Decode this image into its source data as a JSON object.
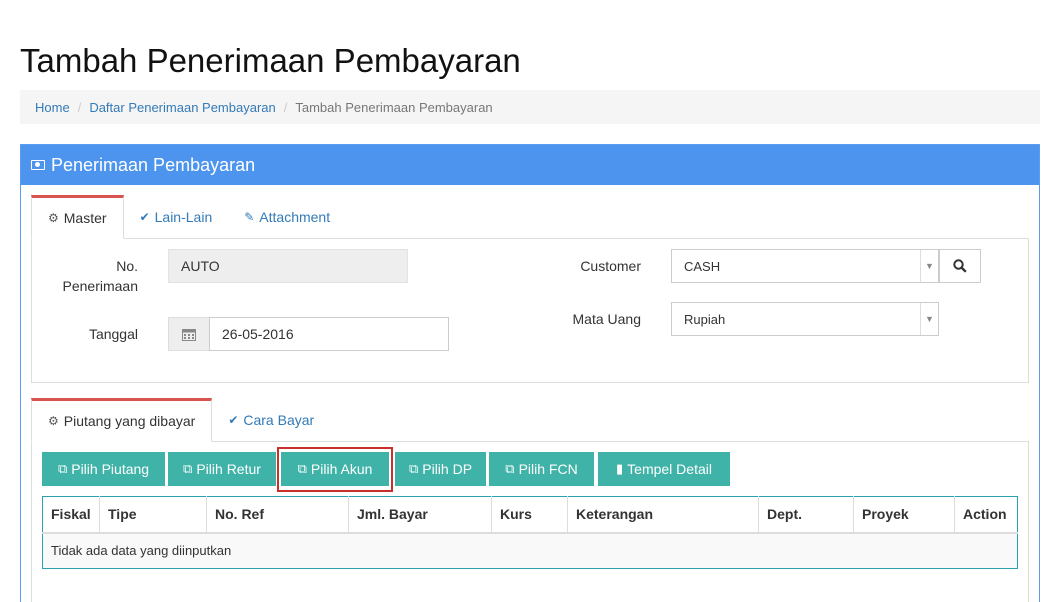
{
  "page_title": "Tambah Penerimaan Pembayaran",
  "breadcrumb": {
    "home": "Home",
    "list": "Daftar Penerimaan Pembayaran",
    "current": "Tambah Penerimaan Pembayaran",
    "separator": "/"
  },
  "panel": {
    "title": "Penerimaan Pembayaran",
    "icon": "money-icon"
  },
  "top_tabs": {
    "master": "Master",
    "lain": "Lain-Lain",
    "attachment": "Attachment"
  },
  "form": {
    "no_label_1": "No.",
    "no_label_2": "Penerimaan",
    "no_value": "AUTO",
    "tanggal_label": "Tanggal",
    "tanggal_value": "26-05-2016",
    "customer_label": "Customer",
    "customer_value": "CASH",
    "mata_uang_label": "Mata Uang",
    "mata_uang_value": "Rupiah"
  },
  "detail_tabs": {
    "piutang": "Piutang yang dibayar",
    "cara_bayar": "Cara Bayar"
  },
  "buttons": {
    "pilih_piutang": "Pilih Piutang",
    "pilih_retur": "Pilih Retur",
    "pilih_akun": "Pilih Akun",
    "pilih_dp": "Pilih DP",
    "pilih_fcn": "Pilih FCN",
    "tempel_detail": "Tempel Detail"
  },
  "table": {
    "headers": [
      "Fiskal",
      "Tipe",
      "No. Ref",
      "Jml. Bayar",
      "Kurs",
      "Keterangan",
      "Dept.",
      "Proyek",
      "Action"
    ],
    "empty_message": "Tidak ada data yang diinputkan"
  },
  "colors": {
    "panel_heading": "#4d94ef",
    "button": "#3fb3a8",
    "active_tab_border": "#d9534f",
    "highlight": "#c9302c"
  }
}
